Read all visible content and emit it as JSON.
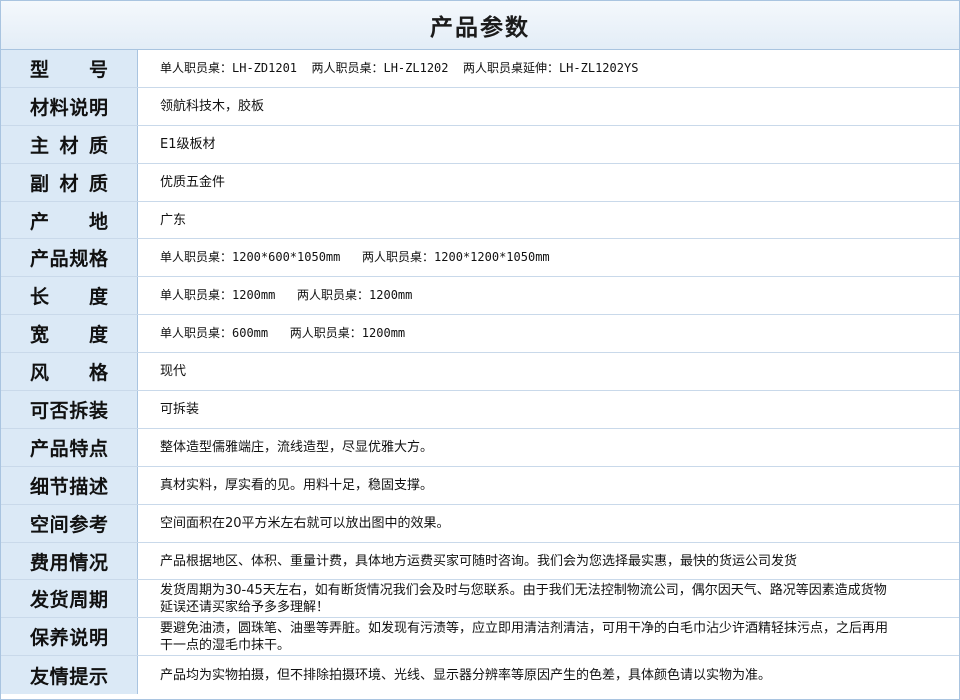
{
  "title": "产品参数",
  "rows": [
    {
      "label": "型    号",
      "value": "单人职员桌：LH-ZD1201  两人职员桌：LH-ZL1202  两人职员桌延伸：LH-ZL1202YS"
    },
    {
      "label": "材料说明",
      "value": "领航科技木，胶板"
    },
    {
      "label": "主 材 质",
      "value": "E1级板材"
    },
    {
      "label": "副 材 质",
      "value": "优质五金件"
    },
    {
      "label": "产    地",
      "value": "广东"
    },
    {
      "label": "产品规格",
      "value": "单人职员桌：1200*600*1050mm   两人职员桌：1200*1200*1050mm"
    },
    {
      "label": "长    度",
      "value": "单人职员桌：1200mm   两人职员桌：1200mm"
    },
    {
      "label": "宽    度",
      "value": "单人职员桌：600mm   两人职员桌：1200mm"
    },
    {
      "label": "风    格",
      "value": "现代"
    },
    {
      "label": "可否拆装",
      "value": "可拆装"
    },
    {
      "label": "产品特点",
      "value": "整体造型儒雅端庄，流线造型，尽显优雅大方。"
    },
    {
      "label": "细节描述",
      "value": "真材实料，厚实看的见。用料十足，稳固支撑。"
    },
    {
      "label": "空间参考",
      "value": "空间面积在20平方米左右就可以放出图中的效果。"
    },
    {
      "label": "费用情况",
      "value": "产品根据地区、体积、重量计费，具体地方运费买家可随时咨询。我们会为您选择最实惠，最快的货运公司发货"
    },
    {
      "label": "发货周期",
      "value": "发货周期为30-45天左右，如有断货情况我们会及时与您联系。由于我们无法控制物流公司，偶尔因天气、路况等因素造成货物延误还请买家给予多多理解！"
    },
    {
      "label": "保养说明",
      "value": "要避免油渍，圆珠笔、油墨等弄脏。如发现有污渍等，应立即用清洁剂清洁，可用干净的白毛巾沾少许酒精轻抹污点，之后再用干一点的湿毛巾抹干。"
    },
    {
      "label": "友情提示",
      "value": "产品均为实物拍摄，但不排除拍摄环境、光线、显示器分辨率等原因产生的色差，具体颜色请以实物为准。"
    }
  ]
}
